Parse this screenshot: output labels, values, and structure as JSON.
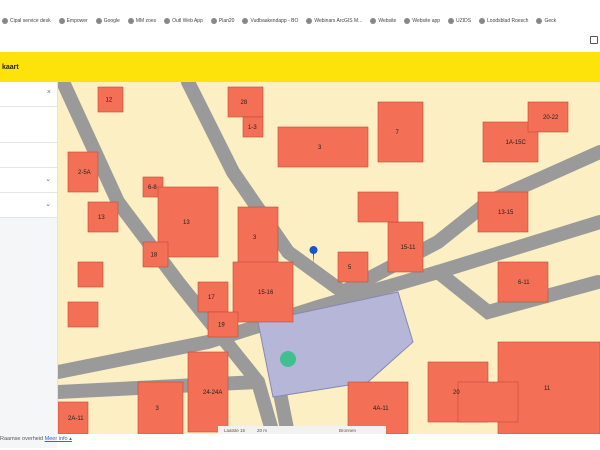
{
  "bookmarks": [
    {
      "label": "Cipal service desk",
      "icon": "bookmark-icon"
    },
    {
      "label": "Empower",
      "icon": "play-icon"
    },
    {
      "label": "Google",
      "icon": "google-icon"
    },
    {
      "label": "MM zoes",
      "icon": "globe-icon"
    },
    {
      "label": "Outl Web App",
      "icon": "outlook-icon"
    },
    {
      "label": "Plan20",
      "icon": "globe-icon"
    },
    {
      "label": "Vudbaakendapp - BO",
      "icon": "app-icon"
    },
    {
      "label": "Webinars ArcGIS M...",
      "icon": "bookmark-icon"
    },
    {
      "label": "Website",
      "icon": "link-icon"
    },
    {
      "label": "Website app",
      "icon": "link-icon"
    },
    {
      "label": "UZIDS",
      "icon": "app-icon"
    },
    {
      "label": "Loodsblad Roesch",
      "icon": "app-icon"
    },
    {
      "label": "Geck",
      "icon": "globe-icon"
    }
  ],
  "banner": {
    "title": "kaart"
  },
  "panel": {
    "close_icon": "×",
    "chevron": "⌄"
  },
  "map": {
    "labels": [
      "12",
      "28",
      "1-3",
      "3",
      "7",
      "2-5A",
      "6-8",
      "13",
      "3",
      "15-16",
      "17",
      "19",
      "18",
      "13",
      "5",
      "15-11",
      "13-15",
      "6-11",
      "1A-15C",
      "20-22",
      "24-24A",
      "3",
      "2A-11",
      "20",
      "11",
      "4A-11"
    ],
    "marker_color": "#1a56c8",
    "building_color": "#f36f55",
    "parcel_color": "#fbefc3",
    "plaza_color": "#b6b6d8"
  },
  "scalebar": {
    "last": "Laatste 15",
    "scale": "20 m",
    "sources": "Bronnen"
  },
  "footer": {
    "text": "Raamse overheid",
    "link": "Meer info ▴"
  }
}
